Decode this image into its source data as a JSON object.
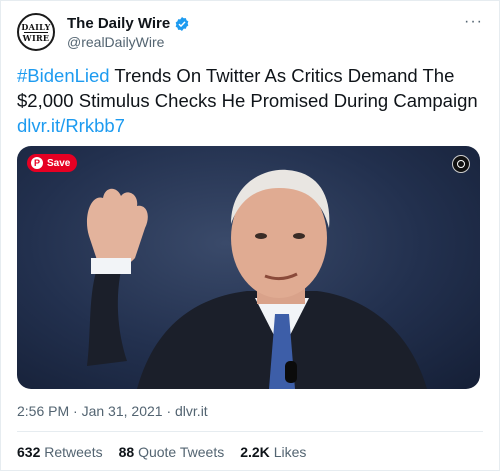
{
  "header": {
    "display_name": "The Daily Wire",
    "handle": "@realDailyWire",
    "avatar_text_top": "DAILY",
    "avatar_text_bottom": "WIRE",
    "more_label": "···"
  },
  "tweet": {
    "hashtag": "#BidenLied",
    "text": " Trends On Twitter As Critics Demand The $2,000 Stimulus Checks He Promised During Campaign ",
    "link": "dlvr.it/Rrkbb7"
  },
  "media": {
    "save_label": "Save",
    "pin_glyph": "P"
  },
  "meta": {
    "time": "2:56 PM",
    "separator": " · ",
    "date": "Jan 31, 2021",
    "source": "dlvr.it"
  },
  "stats": {
    "retweets_count": "632",
    "retweets_label": "Retweets",
    "quotes_count": "88",
    "quotes_label": "Quote Tweets",
    "likes_count": "2.2K",
    "likes_label": "Likes"
  },
  "colors": {
    "accent": "#1d9bf0",
    "pinterest": "#e60023",
    "secondary_text": "#536471"
  }
}
